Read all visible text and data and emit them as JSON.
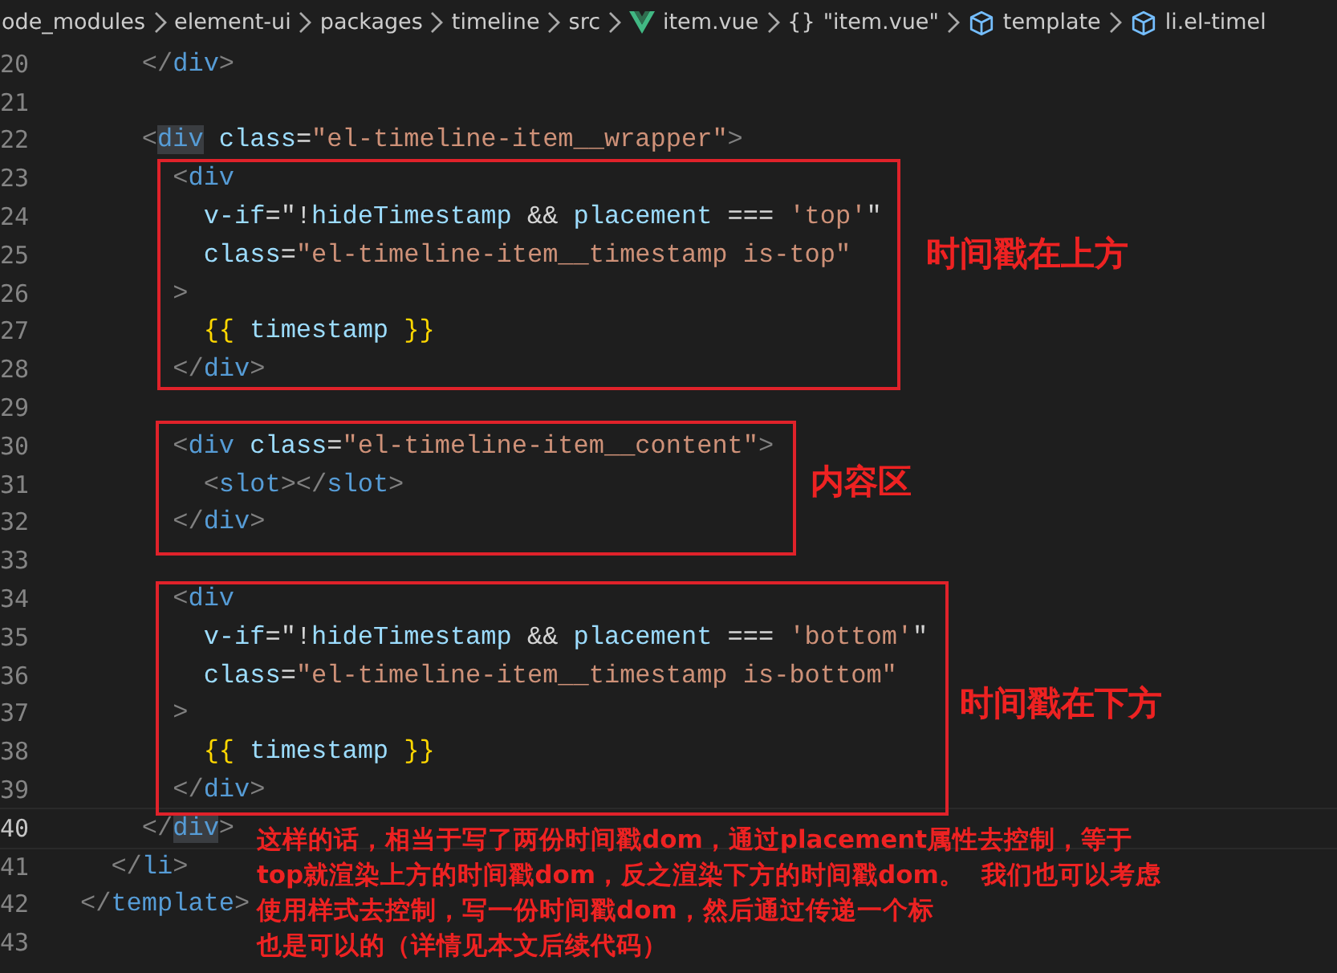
{
  "breadcrumb": [
    {
      "label": "ode_modules"
    },
    {
      "label": "element-ui"
    },
    {
      "label": "packages"
    },
    {
      "label": "timeline"
    },
    {
      "label": "src"
    },
    {
      "label": "item.vue",
      "kind": "vue"
    },
    {
      "label": "\"item.vue\"",
      "kind": "braces",
      "symbol": "{}"
    },
    {
      "label": "template",
      "kind": "cube"
    },
    {
      "label": "li.el-timel",
      "kind": "cube"
    }
  ],
  "lines": [
    {
      "number": "20",
      "tokens": [
        {
          "kind": "punct",
          "text": "    </"
        },
        {
          "kind": "tag",
          "text": "div"
        },
        {
          "kind": "punct",
          "text": ">"
        }
      ]
    },
    {
      "number": "21"
    },
    {
      "number": "22",
      "tokens": [
        {
          "kind": "punct",
          "text": "    <"
        },
        {
          "kind": "tag",
          "text": "div",
          "selected": true
        },
        {
          "kind": "attr",
          "text": " class"
        },
        {
          "kind": "plain",
          "text": "="
        },
        {
          "kind": "string",
          "text": "\"el-timeline-item__wrapper\""
        },
        {
          "kind": "punct",
          "text": ">"
        }
      ]
    },
    {
      "number": "23",
      "tokens": [
        {
          "kind": "punct",
          "text": "      <"
        },
        {
          "kind": "tag",
          "text": "div"
        }
      ]
    },
    {
      "number": "24",
      "tokens": [
        {
          "kind": "attr",
          "text": "        v-if"
        },
        {
          "kind": "plain",
          "text": "=\"!"
        },
        {
          "kind": "attr",
          "text": "hideTimestamp"
        },
        {
          "kind": "plain",
          "text": " && "
        },
        {
          "kind": "attr",
          "text": "placement"
        },
        {
          "kind": "plain",
          "text": " === "
        },
        {
          "kind": "string",
          "text": "'top'"
        },
        {
          "kind": "plain",
          "text": "\""
        }
      ]
    },
    {
      "number": "25",
      "tokens": [
        {
          "kind": "attr",
          "text": "        class"
        },
        {
          "kind": "plain",
          "text": "="
        },
        {
          "kind": "string",
          "text": "\"el-timeline-item__timestamp is-top\""
        }
      ]
    },
    {
      "number": "26",
      "tokens": [
        {
          "kind": "punct",
          "text": "      >"
        }
      ]
    },
    {
      "number": "27",
      "tokens": [
        {
          "kind": "brace",
          "text": "        {{"
        },
        {
          "kind": "attr",
          "text": " timestamp "
        },
        {
          "kind": "brace",
          "text": "}}"
        }
      ]
    },
    {
      "number": "28",
      "tokens": [
        {
          "kind": "punct",
          "text": "      </"
        },
        {
          "kind": "tag",
          "text": "div"
        },
        {
          "kind": "punct",
          "text": ">"
        }
      ]
    },
    {
      "number": "29"
    },
    {
      "number": "30",
      "tokens": [
        {
          "kind": "punct",
          "text": "      <"
        },
        {
          "kind": "tag",
          "text": "div"
        },
        {
          "kind": "attr",
          "text": " class"
        },
        {
          "kind": "plain",
          "text": "="
        },
        {
          "kind": "string",
          "text": "\"el-timeline-item__content\""
        },
        {
          "kind": "punct",
          "text": ">"
        }
      ]
    },
    {
      "number": "31",
      "tokens": [
        {
          "kind": "punct",
          "text": "        <"
        },
        {
          "kind": "tag",
          "text": "slot"
        },
        {
          "kind": "punct",
          "text": "></"
        },
        {
          "kind": "tag",
          "text": "slot"
        },
        {
          "kind": "punct",
          "text": ">"
        }
      ]
    },
    {
      "number": "32",
      "tokens": [
        {
          "kind": "punct",
          "text": "      </"
        },
        {
          "kind": "tag",
          "text": "div"
        },
        {
          "kind": "punct",
          "text": ">"
        }
      ]
    },
    {
      "number": "33"
    },
    {
      "number": "34",
      "tokens": [
        {
          "kind": "punct",
          "text": "      <"
        },
        {
          "kind": "tag",
          "text": "div"
        }
      ]
    },
    {
      "number": "35",
      "tokens": [
        {
          "kind": "attr",
          "text": "        v-if"
        },
        {
          "kind": "plain",
          "text": "=\"!"
        },
        {
          "kind": "attr",
          "text": "hideTimestamp"
        },
        {
          "kind": "plain",
          "text": " && "
        },
        {
          "kind": "attr",
          "text": "placement"
        },
        {
          "kind": "plain",
          "text": " === "
        },
        {
          "kind": "string",
          "text": "'bottom'"
        },
        {
          "kind": "plain",
          "text": "\""
        }
      ]
    },
    {
      "number": "36",
      "tokens": [
        {
          "kind": "attr",
          "text": "        class"
        },
        {
          "kind": "plain",
          "text": "="
        },
        {
          "kind": "string",
          "text": "\"el-timeline-item__timestamp is-bottom\""
        }
      ]
    },
    {
      "number": "37",
      "tokens": [
        {
          "kind": "punct",
          "text": "      >"
        }
      ]
    },
    {
      "number": "38",
      "tokens": [
        {
          "kind": "brace",
          "text": "        {{"
        },
        {
          "kind": "attr",
          "text": " timestamp "
        },
        {
          "kind": "brace",
          "text": "}}"
        }
      ]
    },
    {
      "number": "39",
      "tokens": [
        {
          "kind": "punct",
          "text": "      </"
        },
        {
          "kind": "tag",
          "text": "div"
        },
        {
          "kind": "punct",
          "text": ">"
        }
      ]
    },
    {
      "number": "40",
      "current": true,
      "tokens": [
        {
          "kind": "punct",
          "text": "    </"
        },
        {
          "kind": "tag",
          "text": "div",
          "selected": true
        },
        {
          "kind": "punct",
          "text": ">"
        }
      ]
    },
    {
      "number": "41",
      "tokens": [
        {
          "kind": "punct",
          "text": "  </"
        },
        {
          "kind": "tag",
          "text": "li"
        },
        {
          "kind": "punct",
          "text": ">"
        }
      ]
    },
    {
      "number": "42",
      "tokens": [
        {
          "kind": "punct",
          "text": "</"
        },
        {
          "kind": "tag",
          "text": "template"
        },
        {
          "kind": "punct",
          "text": ">"
        }
      ]
    },
    {
      "number": "43"
    }
  ],
  "annotations": [
    {
      "kind": "box",
      "label": "时间戳在上方"
    },
    {
      "kind": "box",
      "label": "内容区"
    },
    {
      "kind": "box",
      "label": "时间戳在下方"
    }
  ],
  "note": [
    "这样的话，相当于写了两份时间戳dom，通过placement属性去控制，等于",
    "top就渲染上方的时间戳dom，反之渲染下方的时间戳dom。  我们也可以考虑",
    "使用样式去控制，写一份时间戳dom，然后通过传递一个标",
    "也是可以的（详情见本文后续代码）"
  ]
}
